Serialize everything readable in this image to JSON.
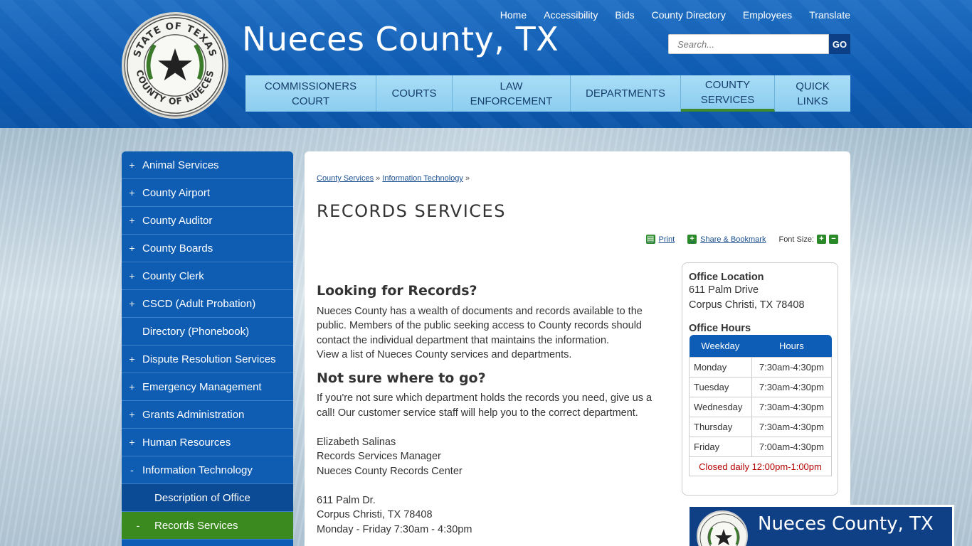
{
  "site": {
    "title": "Nueces County, TX",
    "seal_top_text": "STATE OF TEXAS",
    "seal_bottom_text": "COUNTY OF NUECES"
  },
  "util_nav": [
    "Home",
    "Accessibility",
    "Bids",
    "County Directory",
    "Employees",
    "Translate"
  ],
  "search": {
    "placeholder": "Search...",
    "button": "GO"
  },
  "main_nav": [
    {
      "label": "COMMISSIONERS COURT",
      "line1": "COMMISSIONERS",
      "line2": "COURT"
    },
    {
      "label": "COURTS",
      "line1": "COURTS",
      "line2": ""
    },
    {
      "label": "LAW ENFORCEMENT",
      "line1": "LAW",
      "line2": "ENFORCEMENT"
    },
    {
      "label": "DEPARTMENTS",
      "line1": "DEPARTMENTS",
      "line2": ""
    },
    {
      "label": "COUNTY SERVICES",
      "line1": "COUNTY",
      "line2": "SERVICES",
      "active": true
    },
    {
      "label": "QUICK LINKS",
      "line1": "QUICK",
      "line2": "LINKS"
    }
  ],
  "sidebar": [
    {
      "sign": "+",
      "label": "Animal Services"
    },
    {
      "sign": "+",
      "label": "County Airport"
    },
    {
      "sign": "+",
      "label": "County Auditor"
    },
    {
      "sign": "+",
      "label": "County Boards"
    },
    {
      "sign": "+",
      "label": "County Clerk"
    },
    {
      "sign": "+",
      "label": "CSCD (Adult Probation)"
    },
    {
      "sign": "",
      "label": "Directory (Phonebook)"
    },
    {
      "sign": "+",
      "label": "Dispute Resolution Services"
    },
    {
      "sign": "+",
      "label": "Emergency Management"
    },
    {
      "sign": "+",
      "label": "Grants Administration"
    },
    {
      "sign": "+",
      "label": "Human Resources"
    },
    {
      "sign": "-",
      "label": "Information Technology"
    },
    {
      "sign": "",
      "label": "Description of Office",
      "sub": true
    },
    {
      "sign": "-",
      "label": "Records Services",
      "sub": true,
      "current": true
    }
  ],
  "breadcrumb": {
    "link1": "County Services",
    "sep": "»",
    "link2": "Information Technology"
  },
  "page_title": "RECORDS SERVICES",
  "tools": {
    "print": "Print",
    "share": "Share & Bookmark",
    "font_size": "Font Size:"
  },
  "content": {
    "h1": "Looking for Records?",
    "p1": "Nueces County has a wealth of documents and records available to the public. Members of the public seeking access to County records should contact the individual department that maintains the information.",
    "p1b": "View a list of Nueces County services and departments.",
    "h2": "Not sure where to go?",
    "p2": "If you're not sure which department holds the records you need, give us a call! Our customer service staff will help you to the correct department.",
    "contact_name": "Elizabeth Salinas",
    "contact_title": "Records Services Manager",
    "contact_org": "Nueces County Records Center",
    "address1": "611 Palm Dr.",
    "address2": "Corpus Christi, TX 78408",
    "hours_line": "Monday - Friday 7:30am - 4:30pm"
  },
  "office": {
    "location_title": "Office Location",
    "street": "611 Palm Drive",
    "city": "Corpus Christi, TX 78408",
    "hours_title": "Office Hours",
    "col_day": "Weekday",
    "col_hours": "Hours",
    "rows": [
      {
        "day": "Monday",
        "hours": "7:30am-4:30pm"
      },
      {
        "day": "Tuesday",
        "hours": "7:30am-4:30pm"
      },
      {
        "day": "Wednesday",
        "hours": "7:30am-4:30pm"
      },
      {
        "day": "Thursday",
        "hours": "7:30am-4:30pm"
      },
      {
        "day": "Friday",
        "hours": "7:00am-4:30pm"
      }
    ],
    "closed": "Closed daily 12:00pm-1:00pm"
  },
  "footer": {
    "title": "Nueces County, TX"
  },
  "colors": {
    "header_blue": "#0d5cb5",
    "nav_light": "#8ccdf0",
    "active_green": "#3a8a1f",
    "closed_red": "#b30000"
  }
}
